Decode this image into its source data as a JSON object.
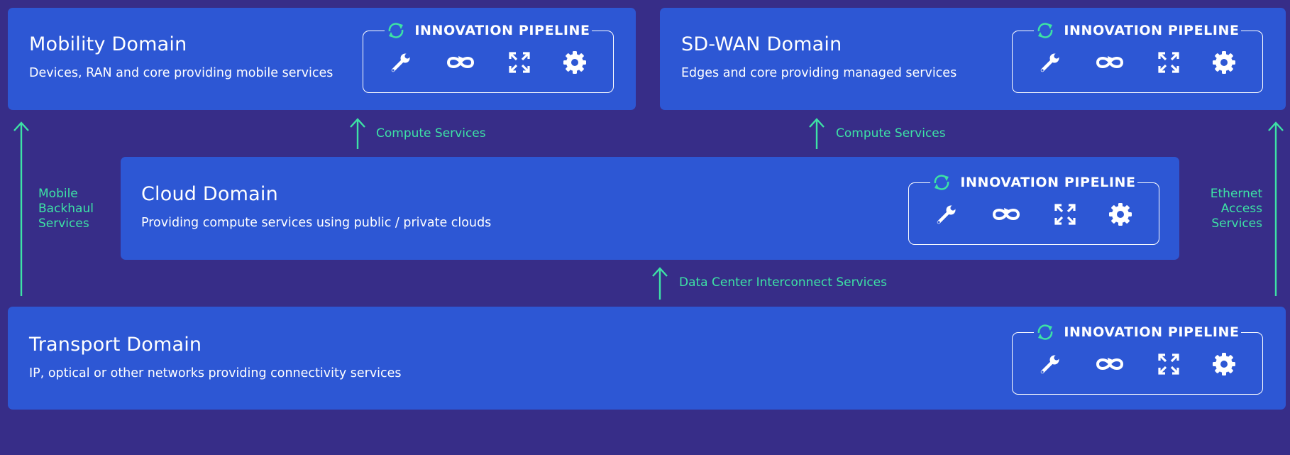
{
  "domains": {
    "mobility": {
      "title": "Mobility Domain",
      "description": "Devices, RAN and core providing mobile services",
      "pipeline_label": "INNOVATION PIPELINE"
    },
    "sdwan": {
      "title": "SD-WAN Domain",
      "description": "Edges and core providing managed services",
      "pipeline_label": "INNOVATION PIPELINE"
    },
    "cloud": {
      "title": "Cloud Domain",
      "description": "Providing compute services using public / private clouds",
      "pipeline_label": "INNOVATION PIPELINE"
    },
    "transport": {
      "title": "Transport Domain",
      "description": "IP, optical or other networks providing connectivity services",
      "pipeline_label": "INNOVATION PIPELINE"
    }
  },
  "flows": {
    "compute_left": "Compute Services",
    "compute_right": "Compute Services",
    "dci": "Data Center Interconnect Services",
    "mobile_backhaul": [
      "Mobile",
      "Backhaul",
      "Services"
    ],
    "ethernet_access": [
      "Ethernet",
      "Access",
      "Services"
    ]
  },
  "icons": {
    "pipeline_cycle": "cycle-arrows-icon",
    "tools": [
      "wrench-icon",
      "infinity-loop-icon",
      "expand-arrows-icon",
      "gear-icon"
    ]
  },
  "colors": {
    "background": "#372d88",
    "panel": "#2d57d4",
    "accent": "#3de2a5",
    "text": "#ffffff"
  }
}
